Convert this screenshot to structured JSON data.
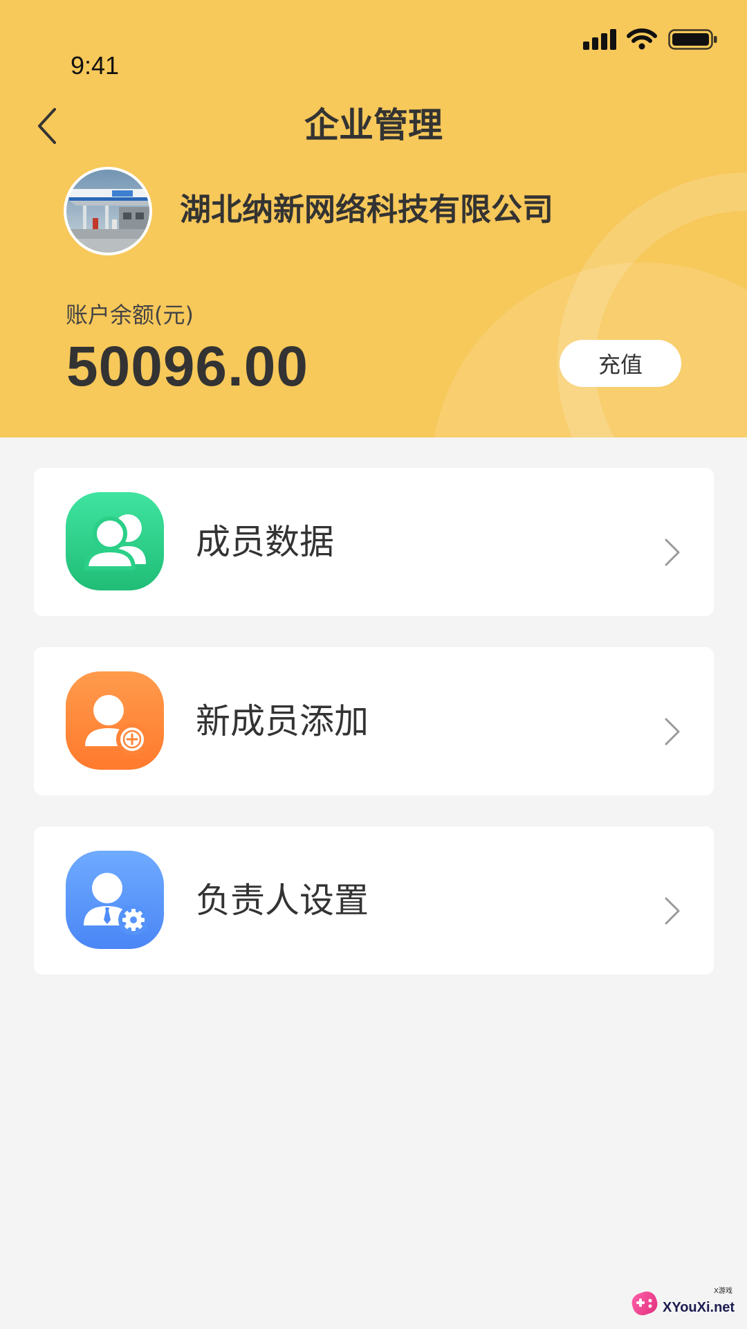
{
  "status_bar": {
    "time": "9:41",
    "icons": [
      "signal-icon",
      "wifi-icon",
      "battery-icon"
    ]
  },
  "header": {
    "title": "企业管理",
    "back_icon": "chevron-left-icon"
  },
  "company": {
    "name": "湖北纳新网络科技有限公司",
    "avatar": "gas-station-photo"
  },
  "balance": {
    "label": "账户余额(元)",
    "amount": "50096.00",
    "recharge_label": "充值"
  },
  "menu": {
    "items": [
      {
        "label": "成员数据",
        "icon": "members-icon",
        "color": "#2cd088"
      },
      {
        "label": "新成员添加",
        "icon": "add-member-icon",
        "color": "#ff8438"
      },
      {
        "label": "负责人设置",
        "icon": "manager-settings-icon",
        "color": "#5a97fb"
      }
    ],
    "chevron_icon": "chevron-right-icon"
  },
  "colors": {
    "header_bg": "#f7c85a",
    "page_bg": "#f4f4f4",
    "card_bg": "#ffffff",
    "text_primary": "#333333"
  },
  "watermark": {
    "brand": "X游戏",
    "site": "XYouXi.net"
  }
}
